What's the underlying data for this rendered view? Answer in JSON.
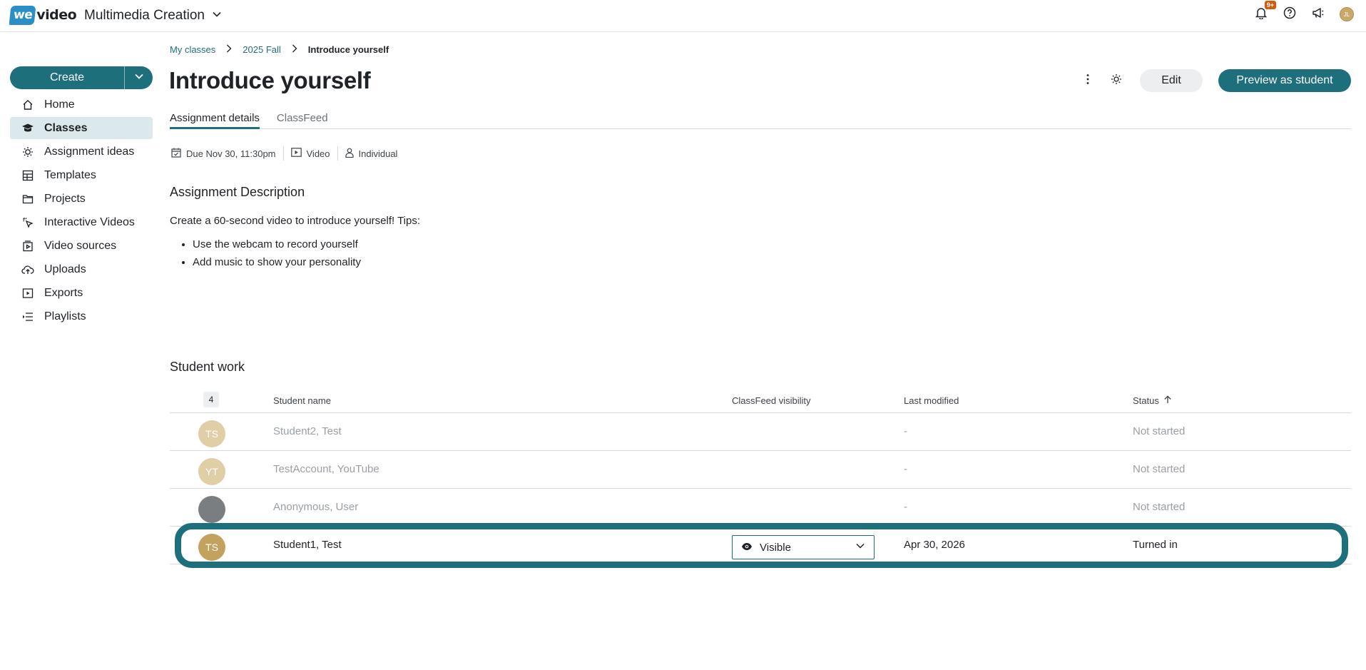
{
  "app": {
    "logo_we": "we",
    "logo_video": "video",
    "workspace": "Multimedia Creation",
    "notification_badge": "9+",
    "user_initials": "JL"
  },
  "sidebar": {
    "create_label": "Create",
    "items": [
      {
        "label": "Home",
        "icon": "home-icon"
      },
      {
        "label": "Classes",
        "icon": "classes-icon",
        "active": true
      },
      {
        "label": "Assignment ideas",
        "icon": "lightbulb-icon"
      },
      {
        "label": "Templates",
        "icon": "templates-icon"
      },
      {
        "label": "Projects",
        "icon": "folder-icon"
      },
      {
        "label": "Interactive Videos",
        "icon": "cursor-click-icon"
      },
      {
        "label": "Video sources",
        "icon": "video-sources-icon"
      },
      {
        "label": "Uploads",
        "icon": "cloud-upload-icon"
      },
      {
        "label": "Exports",
        "icon": "export-icon"
      },
      {
        "label": "Playlists",
        "icon": "playlist-icon"
      }
    ]
  },
  "breadcrumb": {
    "items": [
      "My classes",
      "2025 Fall",
      "Introduce yourself"
    ]
  },
  "page": {
    "title": "Introduce yourself",
    "edit_label": "Edit",
    "preview_label": "Preview as student"
  },
  "tabs": {
    "details": "Assignment details",
    "classfeed": "ClassFeed"
  },
  "meta": {
    "due": "Due Nov 30, 11:30pm",
    "type": "Video",
    "grouping": "Individual"
  },
  "description": {
    "title": "Assignment Description",
    "text": "Create a 60-second video to introduce yourself! Tips:",
    "bullets": [
      "Use the webcam to record yourself",
      "Add music to show your personality"
    ]
  },
  "student_work": {
    "title": "Student work",
    "count": "4",
    "columns": {
      "name": "Student name",
      "visibility": "ClassFeed visibility",
      "modified": "Last modified",
      "status": "Status"
    },
    "rows": [
      {
        "initials": "TS",
        "name": "Student2, Test",
        "modified": "-",
        "status": "Not started",
        "avatar_color": "#e0cfa6"
      },
      {
        "initials": "YT",
        "name": "TestAccount, YouTube",
        "modified": "-",
        "status": "Not started",
        "avatar_color": "#e0cfa6"
      },
      {
        "initials": "",
        "name": "Anonymous, User",
        "modified": "-",
        "status": "Not started",
        "avatar_color": "#7b7e80"
      },
      {
        "initials": "TS",
        "name": "Student1, Test",
        "visibility": "Visible",
        "modified": "Apr 30, 2026",
        "status": "Turned in",
        "avatar_color": "#c3a25f"
      }
    ]
  },
  "colors": {
    "accent": "#1e6f7c",
    "badge": "#d45a0b"
  }
}
